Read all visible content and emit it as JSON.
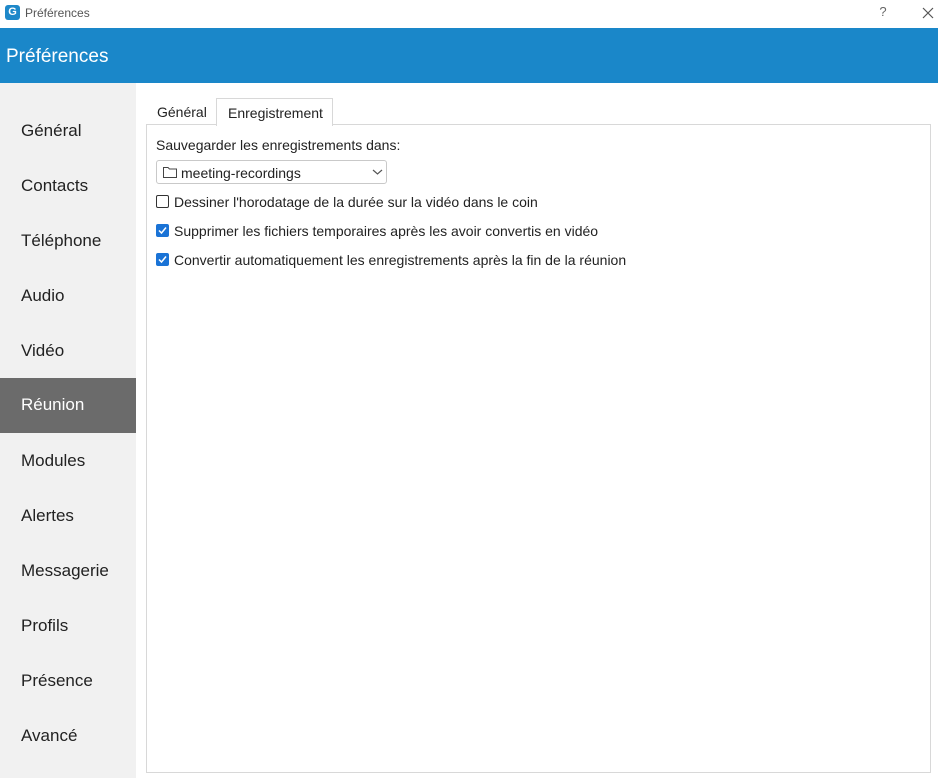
{
  "window": {
    "app_icon": "G",
    "title": "Préférences",
    "help_label": "?",
    "close_icon": "close-icon"
  },
  "header": {
    "title": "Préférences",
    "color": "#1a87c9"
  },
  "sidebar": {
    "active_index": 5,
    "items": [
      {
        "label": "Général"
      },
      {
        "label": "Contacts"
      },
      {
        "label": "Téléphone"
      },
      {
        "label": "Audio"
      },
      {
        "label": "Vidéo"
      },
      {
        "label": "Réunion"
      },
      {
        "label": "Modules"
      },
      {
        "label": "Alertes"
      },
      {
        "label": "Messagerie"
      },
      {
        "label": "Profils"
      },
      {
        "label": "Présence"
      },
      {
        "label": "Avancé"
      }
    ]
  },
  "tabs": [
    {
      "label": "Général",
      "selected": false
    },
    {
      "label": "Enregistrement",
      "selected": true
    }
  ],
  "recording": {
    "save_label": "Sauvegarder les enregistrements dans:",
    "folder_value": "meeting-recordings",
    "options": [
      {
        "label": "Dessiner l'horodatage de la durée sur la vidéo dans le coin",
        "checked": false
      },
      {
        "label": "Supprimer les fichiers temporaires après les avoir convertis en vidéo",
        "checked": true
      },
      {
        "label": "Convertir automatiquement les enregistrements après la fin de la réunion",
        "checked": true
      }
    ]
  },
  "colors": {
    "accent": "#1a87c9",
    "sidebar_active": "#6b6b6b",
    "checkbox_checked": "#1a73d6"
  }
}
